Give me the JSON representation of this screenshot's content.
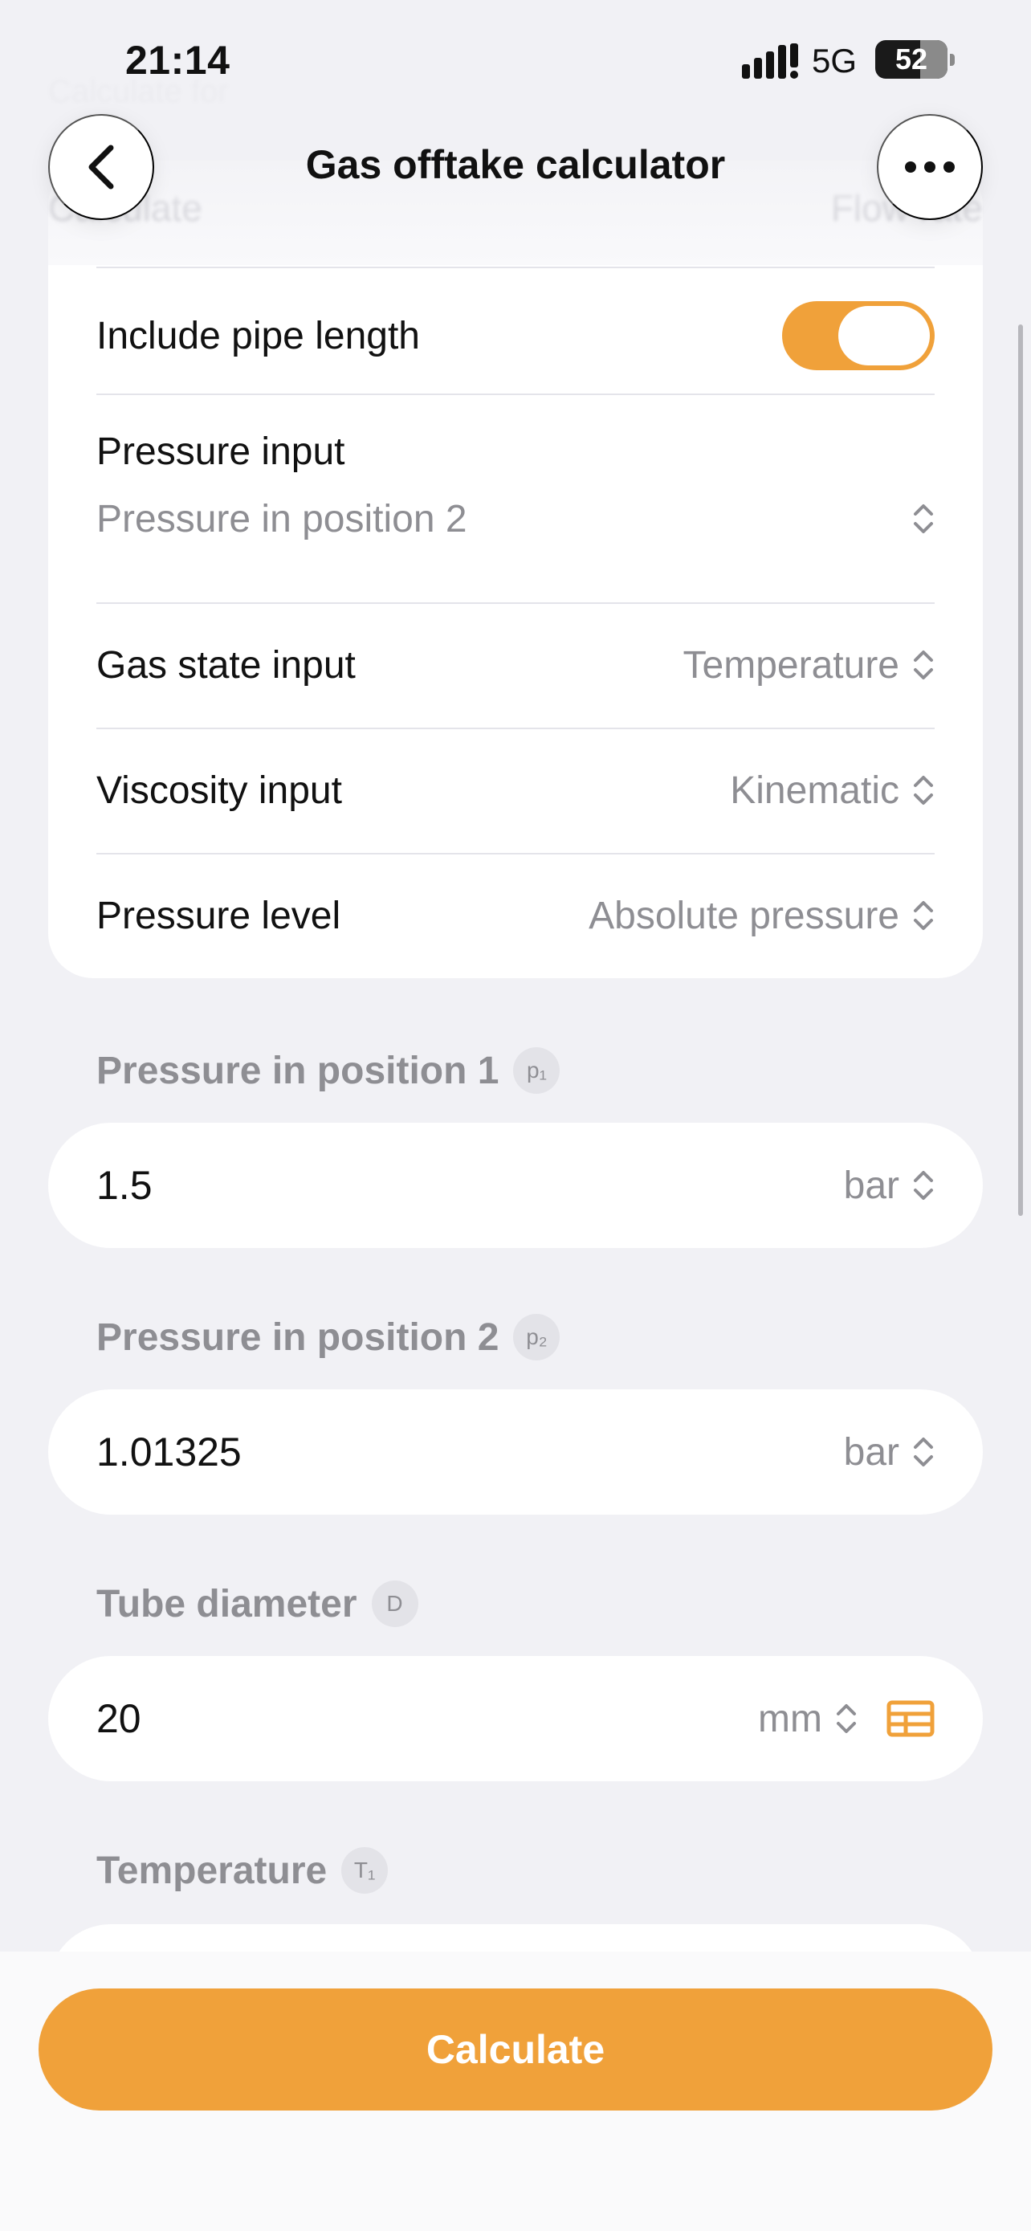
{
  "status_bar": {
    "time": "21:14",
    "network": "5G",
    "battery": "52"
  },
  "nav": {
    "title": "Gas offtake calculator",
    "back_icon": "chevron-left-icon",
    "more_icon": "ellipsis-icon"
  },
  "ghost": {
    "above": "Calculate for",
    "calculate_label": "Calculate",
    "calculate_value": "Flow rate"
  },
  "settings": {
    "include_pipe_length": {
      "label": "Include pipe length",
      "on": true
    },
    "pressure_input": {
      "label": "Pressure input",
      "value": "Pressure in position 2"
    },
    "gas_state_input": {
      "label": "Gas state input",
      "value": "Temperature"
    },
    "viscosity_input": {
      "label": "Viscosity input",
      "value": "Kinematic"
    },
    "pressure_level": {
      "label": "Pressure level",
      "value": "Absolute pressure"
    }
  },
  "fields": {
    "p1": {
      "label": "Pressure in position 1",
      "symbol": "p₁",
      "value": "1.5",
      "unit": "bar"
    },
    "p2": {
      "label": "Pressure in position 2",
      "symbol": "p₂",
      "value": "1.01325",
      "unit": "bar"
    },
    "diameter": {
      "label": "Tube diameter",
      "symbol": "D",
      "value": "20",
      "unit": "mm"
    },
    "temperature": {
      "label": "Temperature",
      "symbol": "T₁"
    }
  },
  "actions": {
    "calculate": "Calculate"
  },
  "colors": {
    "accent": "#f0a13a",
    "background": "#f1f1f5",
    "card": "#ffffff",
    "secondary_text": "#8e8e93"
  }
}
